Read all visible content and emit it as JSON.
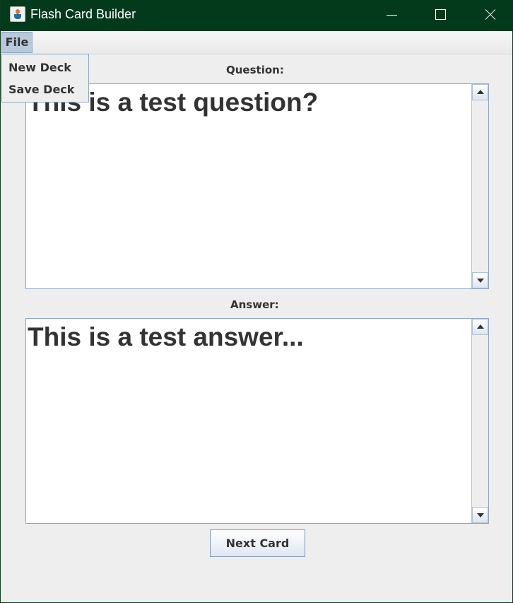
{
  "window": {
    "title": "Flash Card Builder"
  },
  "menubar": {
    "file_label": "File"
  },
  "file_menu": {
    "items": [
      {
        "label": "New Deck"
      },
      {
        "label": "Save Deck"
      }
    ]
  },
  "question": {
    "label": "Question:",
    "value": "This is a test question?"
  },
  "answer": {
    "label": "Answer:",
    "value": "This is a test answer..."
  },
  "actions": {
    "next_label": "Next Card"
  },
  "icons": {
    "app": "java-app-icon",
    "minimize": "minimize-icon",
    "maximize": "maximize-icon",
    "close": "close-icon",
    "scroll_up": "scroll-up-arrow-icon",
    "scroll_down": "scroll-down-arrow-icon"
  },
  "colors": {
    "titlebar": "#033a1c",
    "background": "#eeeeee",
    "menu_selected": "#b8c9dc",
    "text": "#333333",
    "border": "#8fa6bf"
  }
}
